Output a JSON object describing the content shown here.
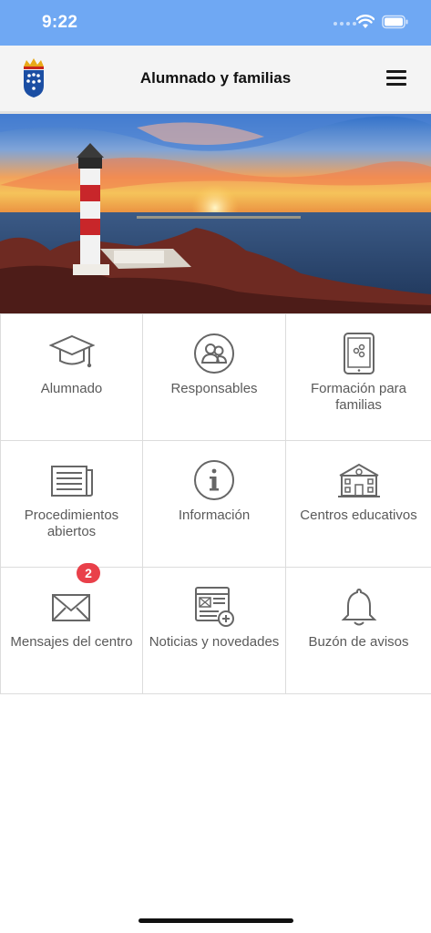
{
  "status_bar": {
    "time": "9:22"
  },
  "header": {
    "title": "Alumnado y familias"
  },
  "colors": {
    "status_bar": "#6fa8f3",
    "badge": "#e9404a",
    "tile_text": "#5a5a5a"
  },
  "tiles": [
    {
      "label": "Alumnado",
      "icon": "graduation-cap-icon"
    },
    {
      "label": "Responsables",
      "icon": "people-icon"
    },
    {
      "label": "Formación para familias",
      "icon": "tablet-icon"
    },
    {
      "label": "Procedimientos abiertos",
      "icon": "newspaper-icon"
    },
    {
      "label": "Información",
      "icon": "info-icon"
    },
    {
      "label": "Centros educativos",
      "icon": "school-building-icon"
    },
    {
      "label": "Mensajes del centro",
      "icon": "envelope-icon",
      "badge": "2"
    },
    {
      "label": "Noticias y novedades",
      "icon": "news-add-icon"
    },
    {
      "label": "Buzón de avisos",
      "icon": "bell-icon"
    }
  ]
}
